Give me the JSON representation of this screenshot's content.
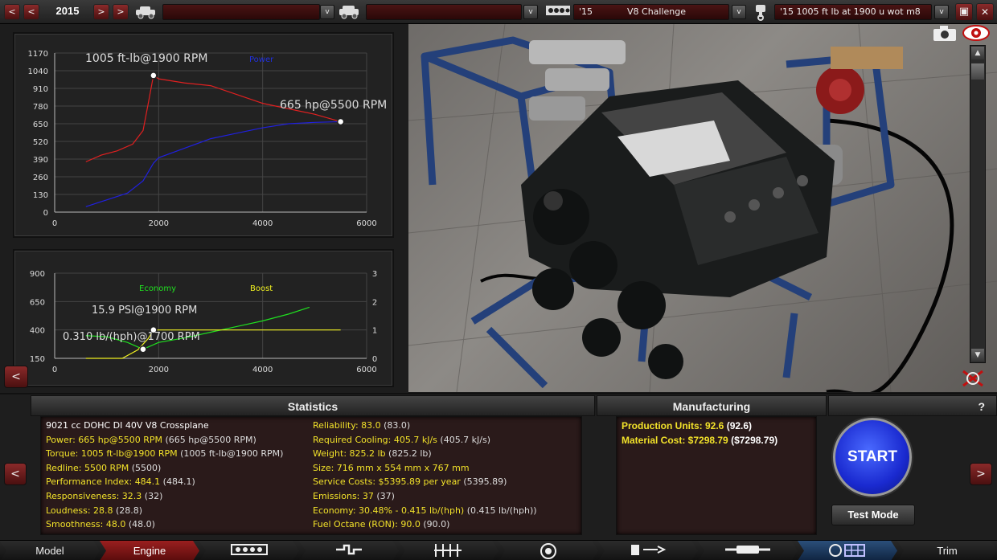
{
  "topbar": {
    "prev_label": "<",
    "next_label": ">",
    "year": "2015",
    "car_model_value": "",
    "car_trim_value": "",
    "engine_family_year": "'15",
    "engine_family_name": "V8 Challenge",
    "engine_variant_name": "'15 1005 ft lb at 1900 u wot m8",
    "dropdown_glyph": "v",
    "save_glyph": "▣",
    "close_glyph": "✕"
  },
  "power_graph": {
    "torque_label": "1005 ft-lb@1900 RPM",
    "power_series_name": "Power",
    "power_label": "665 hp@5500 RPM"
  },
  "economy_graph": {
    "economy_series_name": "Economy",
    "boost_series_name": "Boost",
    "boost_label": "15.9 PSI@1900 RPM",
    "economy_label": "0.310 lb/(hph)@1700 RPM"
  },
  "chart_data": [
    {
      "type": "line",
      "xlim": [
        0,
        6000
      ],
      "ylim": [
        0,
        1170
      ],
      "x_ticks": [
        0,
        2000,
        4000,
        6000
      ],
      "y_ticks": [
        0,
        130,
        260,
        390,
        520,
        650,
        780,
        910,
        1040,
        1170
      ],
      "legend": "top",
      "grid": true,
      "series": [
        {
          "name": "",
          "color": "#e02020",
          "x": [
            600,
            900,
            1200,
            1500,
            1700,
            1800,
            1900,
            2000,
            2500,
            3000,
            4000,
            5000,
            5500
          ],
          "y": [
            370,
            420,
            450,
            500,
            600,
            800,
            1005,
            980,
            950,
            930,
            800,
            720,
            665
          ]
        },
        {
          "name": "Power",
          "color": "#2020e0",
          "x": [
            600,
            1000,
            1400,
            1700,
            1900,
            2000,
            2500,
            3000,
            3500,
            4000,
            4500,
            5000,
            5500
          ],
          "y": [
            40,
            90,
            140,
            230,
            360,
            400,
            470,
            540,
            580,
            620,
            650,
            660,
            665
          ]
        }
      ],
      "annotations": [
        "1005 ft-lb@1900 RPM",
        "665 hp@5500 RPM"
      ]
    },
    {
      "type": "line",
      "xlim": [
        0,
        6000
      ],
      "ylim": [
        150,
        900
      ],
      "y_ticks": [
        150,
        400,
        650,
        900
      ],
      "y2lim": [
        0,
        3
      ],
      "y2_ticks": [
        0,
        1,
        2,
        3
      ],
      "x_ticks": [
        0,
        2000,
        4000,
        6000
      ],
      "legend": "top",
      "grid": true,
      "series": [
        {
          "name": "Economy",
          "axis": "left",
          "color": "#20e020",
          "x": [
            600,
            1000,
            1400,
            1700,
            2000,
            2500,
            3000,
            3500,
            4000,
            4500,
            4900
          ],
          "y": [
            350,
            340,
            290,
            230,
            290,
            330,
            380,
            430,
            480,
            540,
            600
          ]
        },
        {
          "name": "Boost",
          "axis": "right",
          "color": "#f0f020",
          "x": [
            600,
            1300,
            1600,
            1800,
            1900,
            2000,
            3000,
            4000,
            5000,
            5500
          ],
          "y": [
            0,
            0,
            0.3,
            0.7,
            1.0,
            1.0,
            1.0,
            1.0,
            1.0,
            1.0
          ]
        }
      ],
      "annotations": [
        "15.9 PSI@1900 RPM",
        "0.310 lb/(hph)@1700 RPM"
      ]
    }
  ],
  "panels": {
    "statistics_title": "Statistics",
    "manufacturing_title": "Manufacturing",
    "help_label": "?"
  },
  "stats_left": [
    {
      "label": "9021 cc DOHC DI 40V V8 Crossplane",
      "value": ""
    },
    {
      "label": "Power: 665 hp@5500 RPM",
      "value": "(665 hp@5500 RPM)"
    },
    {
      "label": "Torque: 1005 ft-lb@1900 RPM",
      "value": "(1005 ft-lb@1900 RPM)"
    },
    {
      "label": "Redline: 5500 RPM",
      "value": "(5500)"
    },
    {
      "label": "Performance Index: 484.1",
      "value": "(484.1)"
    },
    {
      "label": "Responsiveness: 32.3",
      "value": "(32)"
    },
    {
      "label": "Loudness: 28.8",
      "value": "(28.8)"
    },
    {
      "label": "Smoothness: 48.0",
      "value": "(48.0)"
    }
  ],
  "stats_right": [
    {
      "label": "Reliability: 83.0",
      "value": "(83.0)"
    },
    {
      "label": "Required Cooling: 405.7 kJ/s",
      "value": "(405.7 kJ/s)"
    },
    {
      "label": "Weight: 825.2 lb",
      "value": "(825.2 lb)"
    },
    {
      "label": "Size: 716 mm x 554 mm x 767 mm",
      "value": ""
    },
    {
      "label": "Service Costs: $5395.89 per year",
      "value": "(5395.89)"
    },
    {
      "label": "Emissions: 37",
      "value": "(37)"
    },
    {
      "label": "Economy: 30.48% - 0.415 lb/(hph)",
      "value": "(0.415 lb/(hph))"
    },
    {
      "label": "Fuel Octane (RON): 90.0",
      "value": "(90.0)"
    }
  ],
  "manufacturing": [
    {
      "label": "Production Units: 92.6",
      "value": "(92.6)"
    },
    {
      "label": "Material Cost: $7298.79",
      "value": "($7298.79)"
    }
  ],
  "actions": {
    "start_label": "START",
    "test_mode_label": "Test Mode",
    "left_arrow": "<",
    "right_arrow": ">"
  },
  "nav": [
    {
      "label": "Model",
      "active": false
    },
    {
      "label": "Engine",
      "active": true
    },
    {
      "label": "",
      "icon": "engine-block-icon"
    },
    {
      "label": "",
      "icon": "crankshaft-icon"
    },
    {
      "label": "",
      "icon": "valvetrain-icon"
    },
    {
      "label": "",
      "icon": "turbo-icon"
    },
    {
      "label": "",
      "icon": "fuel-system-icon"
    },
    {
      "label": "",
      "icon": "exhaust-icon"
    },
    {
      "label": "",
      "icon": "tuning-icon"
    },
    {
      "label": "Trim",
      "active": false
    }
  ]
}
